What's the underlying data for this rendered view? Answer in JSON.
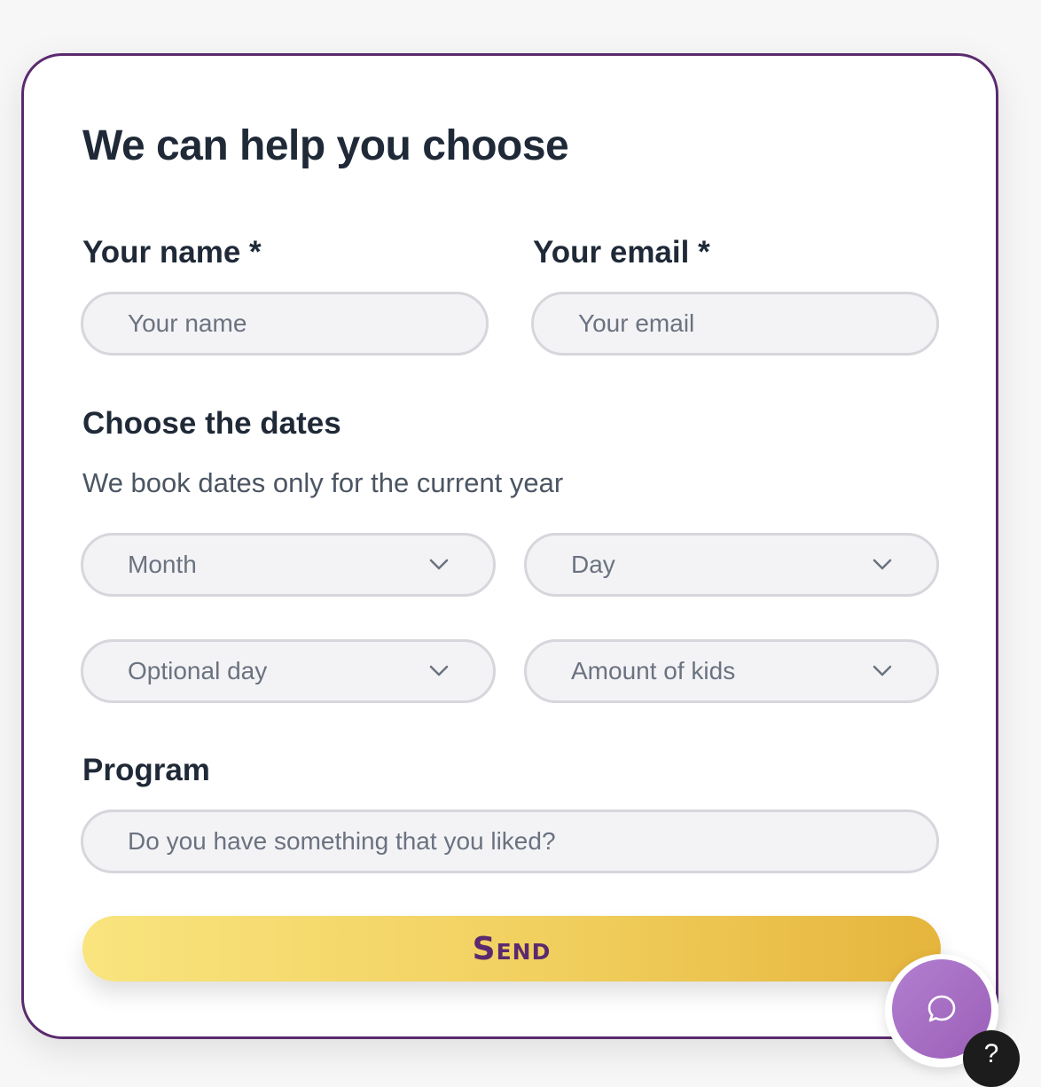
{
  "form": {
    "title": "We can help you choose",
    "name_label": "Your name *",
    "name_placeholder": "Your name",
    "email_label": "Your email *",
    "email_placeholder": "Your email",
    "dates_heading": "Choose the dates",
    "dates_note": "We book dates only for the current year",
    "month_select": "Month",
    "day_select": "Day",
    "optional_day_select": "Optional day",
    "kids_select": "Amount of kids",
    "program_label": "Program",
    "program_placeholder": "Do you have something that you liked?",
    "send_label": "Send"
  },
  "widgets": {
    "help_label": "?"
  },
  "colors": {
    "accent": "#5b2a6e",
    "button_gradient_start": "#f9e47e",
    "button_gradient_end": "#e5b53c",
    "chat_bubble": "#a86fc6"
  },
  "icons": {
    "select_arrow": "chevron-down-icon",
    "chat": "chat-bubble-icon",
    "help": "question-mark-icon"
  }
}
